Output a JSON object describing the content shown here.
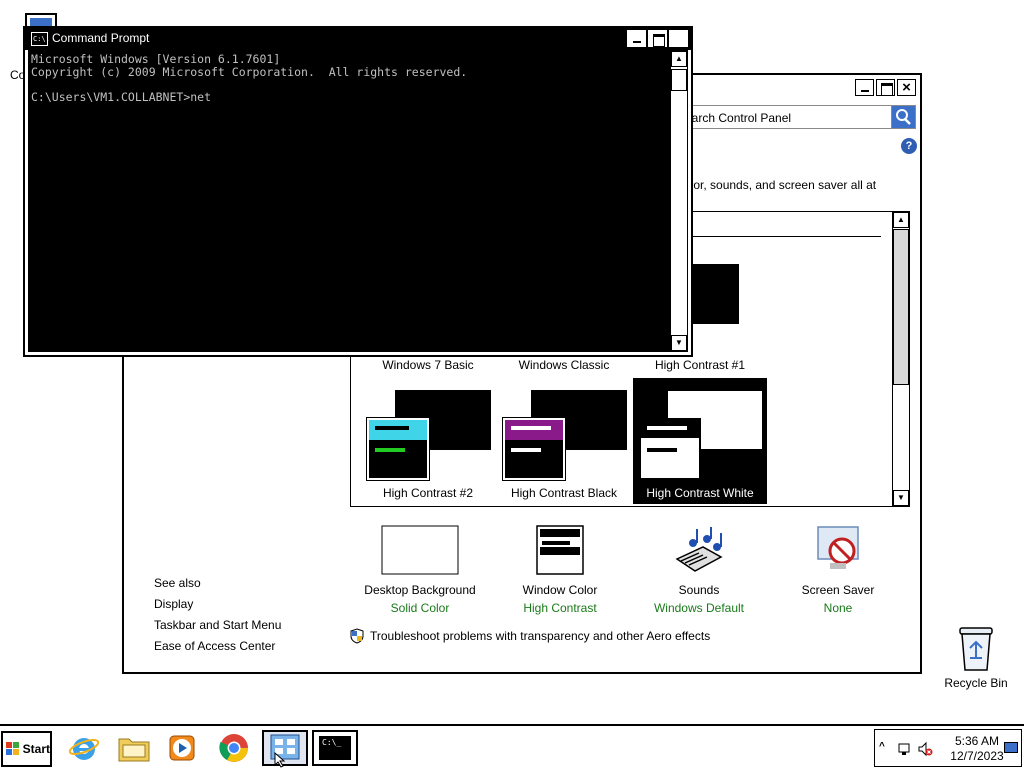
{
  "desktop": {
    "partial_icon_label": "Co",
    "recycle_bin_label": "Recycle Bin"
  },
  "control_panel": {
    "search_placeholder": "earch Control Panel",
    "help_glyph": "?",
    "description": "olor, sounds, and screen saver all at",
    "themes": [
      {
        "label": "Windows 7 Basic"
      },
      {
        "label": "Windows Classic"
      },
      {
        "label": "High Contrast #1"
      },
      {
        "label": "High Contrast #2"
      },
      {
        "label": "High Contrast Black"
      },
      {
        "label": "High Contrast White",
        "selected": true
      }
    ],
    "settings": [
      {
        "name": "Desktop Background",
        "value": "Solid Color"
      },
      {
        "name": "Window Color",
        "value": "High Contrast"
      },
      {
        "name": "Sounds",
        "value": "Windows Default"
      },
      {
        "name": "Screen Saver",
        "value": "None"
      }
    ],
    "see_also": {
      "heading": "See also",
      "links": [
        "Display",
        "Taskbar and Start Menu",
        "Ease of Access Center"
      ]
    },
    "troubleshoot_link": "Troubleshoot problems with transparency and other Aero effects",
    "value_color": "#1a7a1a"
  },
  "command_prompt": {
    "title": "Command Prompt",
    "title_icon_text": "C:\\.",
    "lines": [
      "Microsoft Windows [Version 6.1.7601]",
      "Copyright (c) 2009 Microsoft Corporation.  All rights reserved.",
      "",
      "C:\\Users\\VM1.COLLABNET>net"
    ]
  },
  "taskbar": {
    "start_label": "Start",
    "apps": [
      {
        "name": "internet-explorer",
        "icon": "ie-icon"
      },
      {
        "name": "file-explorer",
        "icon": "folder-icon"
      },
      {
        "name": "media-player",
        "icon": "media-player-icon"
      },
      {
        "name": "chrome",
        "icon": "chrome-icon"
      },
      {
        "name": "control-panel",
        "icon": "control-panel-icon",
        "active": true
      },
      {
        "name": "command-prompt",
        "icon": "cmd-icon",
        "active": true
      }
    ],
    "cmd_icon_text": "C:\\_",
    "clock_time": "5:36 AM",
    "clock_date": "12/7/2023",
    "tray_arrow": "^"
  }
}
